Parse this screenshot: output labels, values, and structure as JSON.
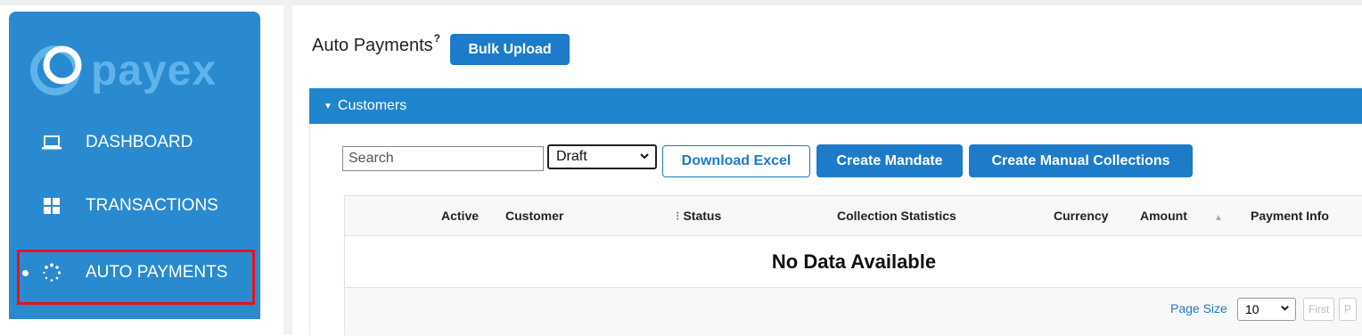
{
  "brand": {
    "name": "payex",
    "logo_color": "#5fb3eb",
    "sidebar_color": "#2a8ad0"
  },
  "sidebar": {
    "items": [
      {
        "label": "DASHBOARD",
        "icon": "laptop-icon"
      },
      {
        "label": "TRANSACTIONS",
        "icon": "grid-icon"
      },
      {
        "label": "AUTO PAYMENTS",
        "icon": "spinner-icon",
        "active": true
      }
    ]
  },
  "header": {
    "title": "Auto Payments",
    "help_mark": "?",
    "bulk_upload_label": "Bulk Upload"
  },
  "panel": {
    "title": "Customers"
  },
  "toolbar": {
    "search_placeholder": "Search",
    "status_value": "Draft",
    "download_label": "Download Excel",
    "create_mandate_label": "Create Mandate",
    "create_manual_label": "Create Manual Collections"
  },
  "table": {
    "columns": [
      "Active",
      "Customer",
      "Status",
      "Collection Statistics",
      "Currency",
      "Amount",
      "Payment Info"
    ],
    "empty_text": "No Data Available",
    "page_size_label": "Page Size",
    "page_size_value": "10",
    "first_label": "First",
    "prev_label": "P"
  },
  "colors": {
    "accent": "#1d7bc9",
    "highlight": "#e0141e"
  }
}
